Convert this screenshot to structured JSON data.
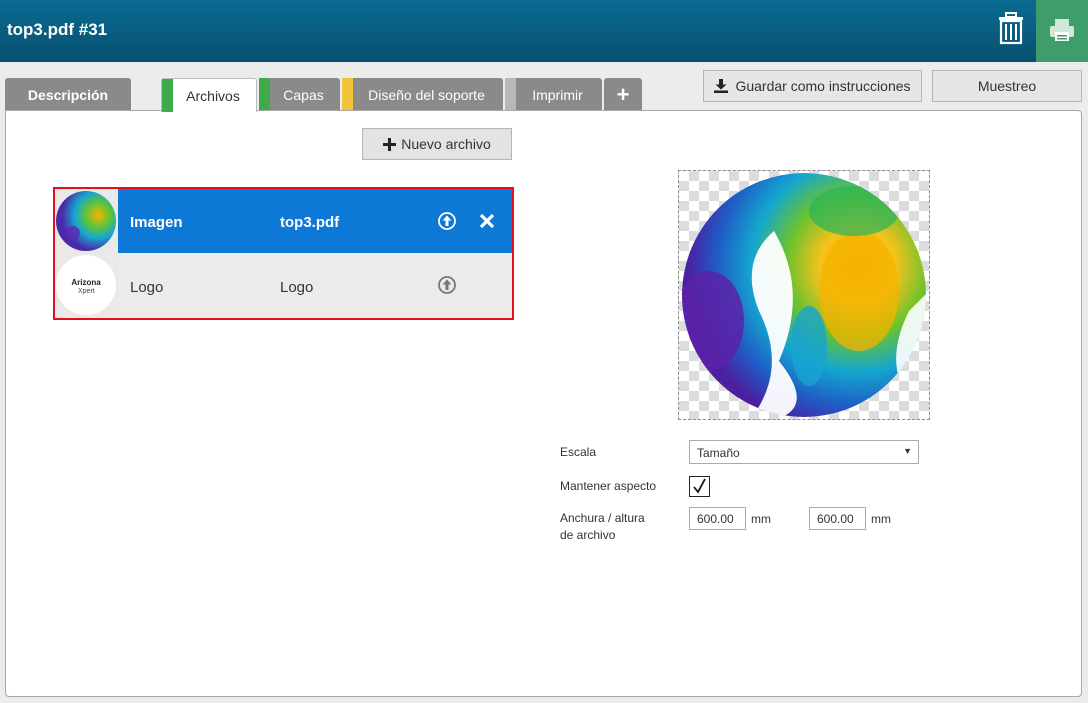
{
  "header": {
    "title": "top3.pdf #31"
  },
  "tabs": [
    {
      "label": "Descripción"
    },
    {
      "label": "Archivos",
      "color": "#3eaa4a"
    },
    {
      "label": "Capas",
      "color": "#3eaa4a"
    },
    {
      "label": "Diseño del soporte",
      "color": "#f2c43a"
    },
    {
      "label": "Imprimir",
      "color": "#b8b8b8"
    },
    {
      "label": "+"
    }
  ],
  "toolbar": {
    "save_label": "Guardar como instrucciones",
    "sample_label": "Muestreo"
  },
  "files": {
    "new_label": "Nuevo archivo",
    "rows": [
      {
        "type": "Imagen",
        "name": "top3.pdf"
      },
      {
        "type": "Logo",
        "name": "Logo",
        "thumb_text_1": "Arizona",
        "thumb_text_2": "Xpert"
      }
    ]
  },
  "form": {
    "scale_label": "Escala",
    "scale_value": "Tamaño",
    "aspect_label": "Mantener aspecto",
    "aspect_checked": true,
    "size_label_1": "Anchura / altura",
    "size_label_2": "de archivo",
    "width_value": "600.00",
    "height_value": "600.00",
    "unit": "mm"
  },
  "colors": {
    "header": "#08506f",
    "selected_row": "#0e78d6",
    "highlight_border": "#e3101b",
    "print_button": "#3e9d6a"
  }
}
